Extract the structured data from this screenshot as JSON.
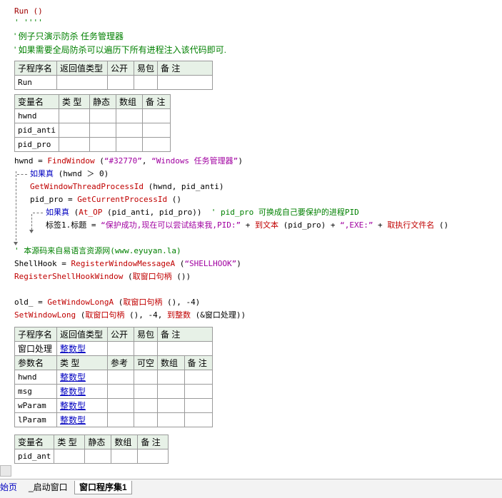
{
  "code": {
    "l1": "Run ()",
    "l2": "' ''''",
    "l3": "' 例子只演示防杀 任务管理器",
    "l4": "' 如果需要全局防杀可以遍历下所有进程注入该代码即可.",
    "line_find": {
      "a": "hwnd = ",
      "fn": "FindWindow",
      "b": " (",
      "s1": "“#32770”",
      "c": ", ",
      "s2": "“Windows 任务管理器”",
      "d": ")"
    },
    "line_if1": {
      "kw": "如果真",
      "rest": " (hwnd ＞ 0)"
    },
    "line_gwtp": {
      "fn": "GetWindowThreadProcessId",
      "rest": " (hwnd, pid_anti)"
    },
    "line_pidpro": {
      "a": "pid_pro = ",
      "fn": "GetCurrentProcessId",
      "rest": " ()"
    },
    "line_if2": {
      "kw": "如果真",
      "a": " (",
      "fn": "At_OP",
      "b": " (pid_anti, pid_pro))  ",
      "cm": "' pid_pro 可换成自己要保护的进程PID"
    },
    "line_label": {
      "a": "标签1.标题 = ",
      "s1": "“保护成功,现在可以尝试结束我,PID:”",
      "b": " + ",
      "fn1": "到文本",
      "c": " (pid_pro) + ",
      "s2": "“,EXE:”",
      "d": " + ",
      "fn2": "取执行文件名",
      "e": " ()"
    },
    "line_src": "' 本源码来自易语言资源网(www.eyuyan.la)",
    "line_shell": {
      "a": "ShellHook = ",
      "fn": "RegisterWindowMessageA",
      "b": " (",
      "s": "“SHELLHOOK”",
      "c": ")"
    },
    "line_reg": {
      "fn": "RegisterShellHookWindow",
      "a": " (",
      "fn2": "取窗口句柄",
      "b": " ())"
    },
    "line_old": {
      "a": "old_ = ",
      "fn": "GetWindowLongA",
      "b": " (",
      "fn2": "取窗口句柄",
      "c": " (), -4)"
    },
    "line_set": {
      "fn": "SetWindowLong",
      "a": " (",
      "fn2": "取窗口句柄",
      "b": " (), -4, ",
      "fn3": "到整数",
      "c": " (&窗口处理))"
    }
  },
  "table1": {
    "headers": [
      "子程序名",
      "返回值类型",
      "公开",
      "易包",
      "备 注"
    ],
    "row": [
      "Run",
      "",
      "",
      "",
      ""
    ]
  },
  "table2": {
    "headers": [
      "变量名",
      "类 型",
      "静态",
      "数组",
      "备 注"
    ],
    "rows": [
      [
        "hwnd"
      ],
      [
        "pid_anti"
      ],
      [
        "pid_pro"
      ]
    ]
  },
  "table3": {
    "headers": [
      "子程序名",
      "返回值类型",
      "公开",
      "易包",
      "备 注"
    ],
    "row": [
      "窗口处理",
      "整数型"
    ],
    "param_headers": [
      "参数名",
      "类 型",
      "参考",
      "可空",
      "数组",
      "备 注"
    ],
    "params": [
      [
        "hwnd",
        "整数型"
      ],
      [
        "msg",
        "整数型"
      ],
      [
        "wParam",
        "整数型"
      ],
      [
        "lParam",
        "整数型"
      ]
    ]
  },
  "table4": {
    "headers": [
      "变量名",
      "类 型",
      "静态",
      "数组",
      "备 注"
    ],
    "rows": [
      [
        "pid_ant"
      ]
    ]
  },
  "tabs": {
    "t1": "始页",
    "t2": "_启动窗口",
    "t3": "窗口程序集1"
  }
}
